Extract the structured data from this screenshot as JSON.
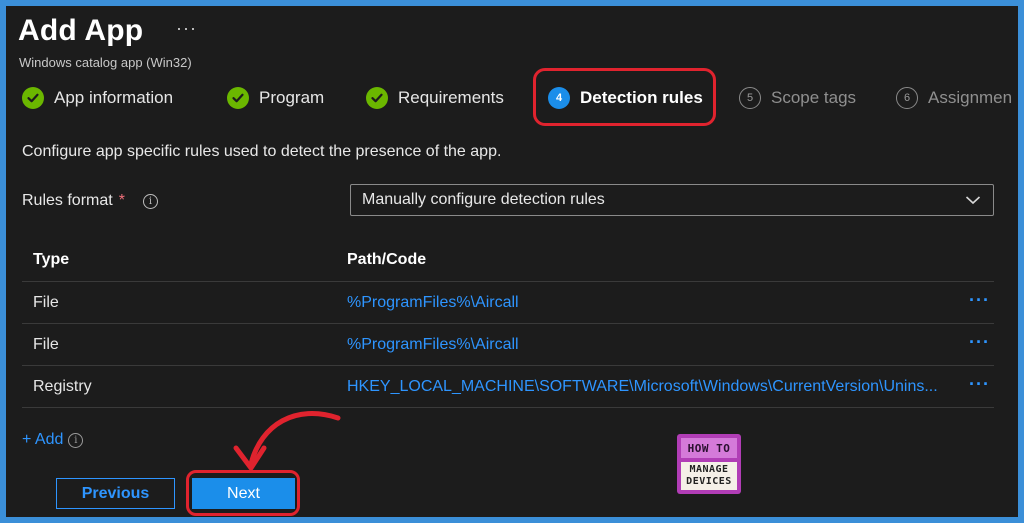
{
  "header": {
    "title": "Add App",
    "more": "···",
    "subtitle": "Windows catalog app (Win32)"
  },
  "steps": [
    {
      "label": "App information",
      "state": "done"
    },
    {
      "label": "Program",
      "state": "done"
    },
    {
      "label": "Requirements",
      "state": "done"
    },
    {
      "label": "Detection rules",
      "state": "active",
      "number": "4"
    },
    {
      "label": "Scope tags",
      "state": "pending",
      "number": "5"
    },
    {
      "label": "Assignmen",
      "state": "pending",
      "number": "6"
    }
  ],
  "description": "Configure app specific rules used to detect the presence of the app.",
  "rules_format": {
    "label": "Rules format",
    "required_mark": "*",
    "info": "i",
    "selected": "Manually configure detection rules"
  },
  "table": {
    "headers": [
      "Type",
      "Path/Code"
    ],
    "rows": [
      {
        "type": "File",
        "path": "%ProgramFiles%\\Aircall",
        "more": "···"
      },
      {
        "type": "File",
        "path": "%ProgramFiles%\\Aircall",
        "more": "···"
      },
      {
        "type": "Registry",
        "path": "HKEY_LOCAL_MACHINE\\SOFTWARE\\Microsoft\\Windows\\CurrentVersion\\Unins...",
        "more": "···"
      }
    ]
  },
  "add": {
    "label": "+ Add",
    "info": "i"
  },
  "buttons": {
    "previous": "Previous",
    "next": "Next"
  },
  "logo": {
    "line1": "HOW TO",
    "line2": "MANAGE",
    "line3": "DEVICES"
  },
  "colors": {
    "accent": "#1b8eea",
    "link": "#2e95ff",
    "success": "#6bb700",
    "highlight": "#e0232e",
    "background": "#1c1c1c"
  }
}
